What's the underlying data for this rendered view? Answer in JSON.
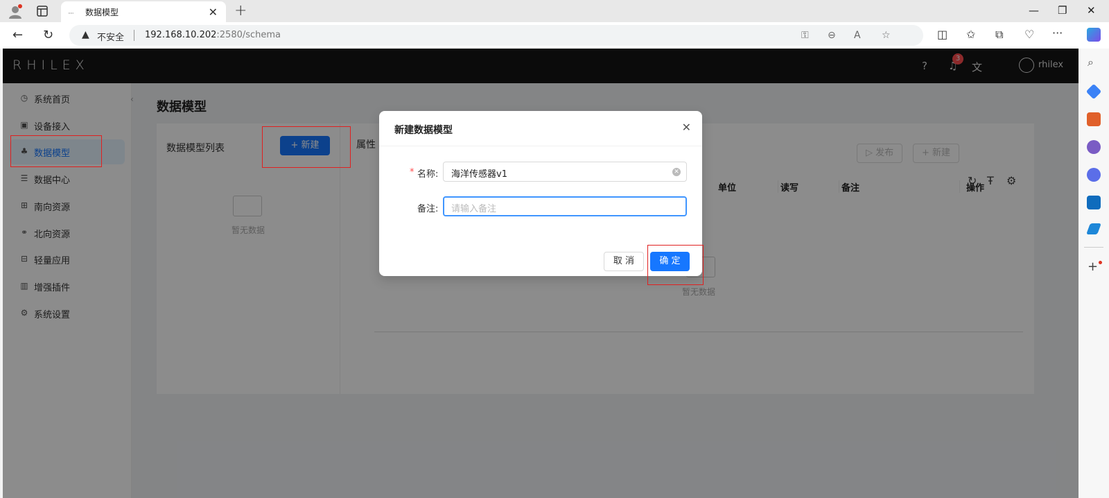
{
  "browser": {
    "tab_title": "数据模型",
    "tab_favicon": "·····",
    "address_security": "不安全",
    "url_host": "192.168.10.202",
    "url_rest": ":2580/schema"
  },
  "app": {
    "logo": "RHILEX",
    "notification_count": "3",
    "username": "rhilex",
    "menu": [
      {
        "label": "系统首页",
        "icon": "dashboard-icon",
        "glyph": "◷"
      },
      {
        "label": "设备接入",
        "icon": "device-icon",
        "glyph": "▣"
      },
      {
        "label": "数据模型",
        "icon": "model-icon",
        "glyph": "♣"
      },
      {
        "label": "数据中心",
        "icon": "database-icon",
        "glyph": "☰"
      },
      {
        "label": "南向资源",
        "icon": "south-resource-icon",
        "glyph": "⊞"
      },
      {
        "label": "北向资源",
        "icon": "north-resource-icon",
        "glyph": "⚭"
      },
      {
        "label": "轻量应用",
        "icon": "apps-icon",
        "glyph": "⊟"
      },
      {
        "label": "增强插件",
        "icon": "plugin-icon",
        "glyph": "▥"
      },
      {
        "label": "系统设置",
        "icon": "settings-icon",
        "glyph": "⚙"
      }
    ],
    "active_menu": "数据模型"
  },
  "page": {
    "title": "数据模型",
    "list_title": "数据模型列表",
    "new_button": "+ 新建",
    "empty_text": "暂无数据",
    "attr_title": "属性",
    "publish_button": "▷ 发布",
    "attr_new_button": "+ 新建",
    "columns": [
      "单位",
      "读写",
      "备注",
      "操作"
    ],
    "table_empty_text": "暂无数据"
  },
  "modal": {
    "title": "新建数据模型",
    "name_label": "名称:",
    "name_value": "海洋传感器v1",
    "remark_label": "备注:",
    "remark_placeholder": "请输入备注",
    "cancel_label": "取 消",
    "ok_label": "确 定"
  },
  "colors": {
    "primary": "#1677ff",
    "annotation": "#e02020",
    "header": "#141414"
  }
}
